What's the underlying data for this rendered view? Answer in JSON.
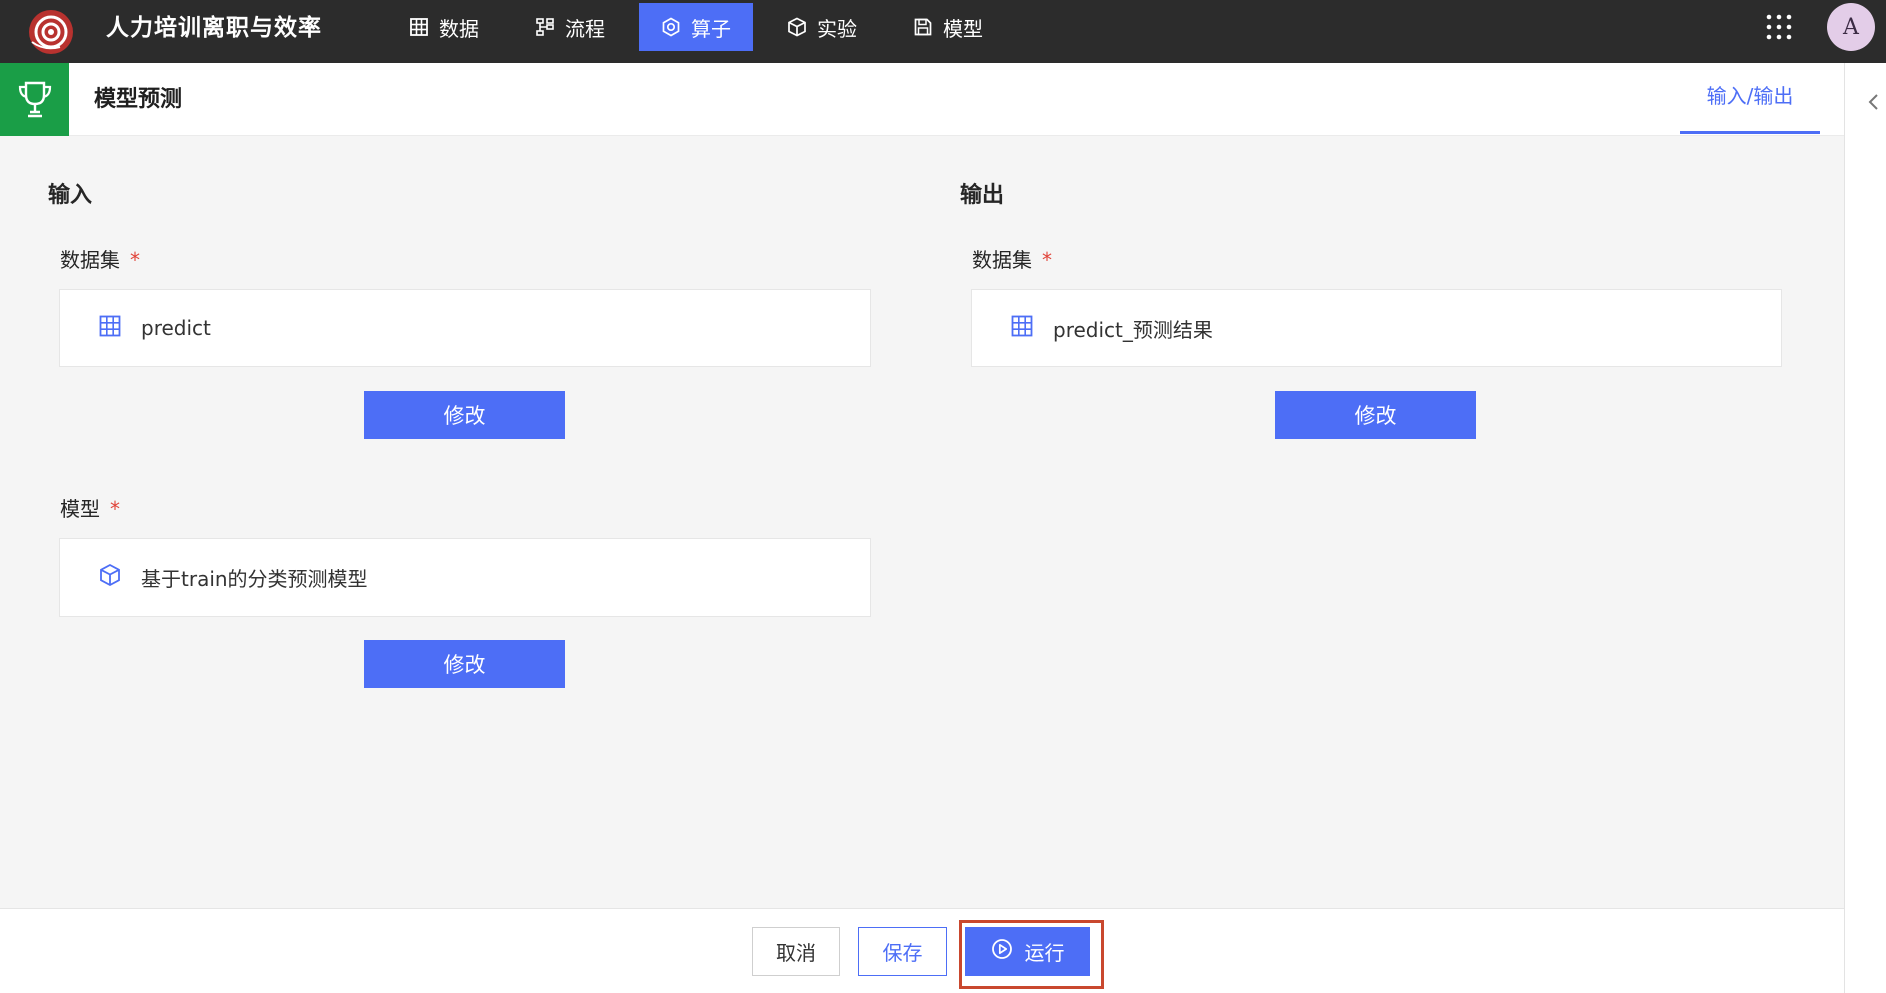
{
  "app": {
    "title": "人力培训离职与效率",
    "avatar_initial": "A",
    "logo_icon": "app-logo-icon",
    "apps_icon": "apps-grid-icon"
  },
  "nav": {
    "active_index": 2,
    "items": [
      {
        "label": "数据",
        "icon": "table-icon"
      },
      {
        "label": "流程",
        "icon": "flow-icon"
      },
      {
        "label": "算子",
        "icon": "operator-icon"
      },
      {
        "label": "实验",
        "icon": "cube-icon"
      },
      {
        "label": "模型",
        "icon": "save-icon"
      }
    ]
  },
  "header": {
    "title": "模型预测",
    "icon": "trophy-icon",
    "tab_label": "输入/输出",
    "side_toggle_icon": "chevron-left-icon"
  },
  "input": {
    "heading": "输入",
    "dataset": {
      "label": "数据集",
      "required": "*",
      "value": "predict",
      "icon": "table-icon",
      "button": "修改"
    },
    "model": {
      "label": "模型",
      "required": "*",
      "value": "基于train的分类预测模型",
      "icon": "cube-icon",
      "button": "修改"
    }
  },
  "output": {
    "heading": "输出",
    "dataset": {
      "label": "数据集",
      "required": "*",
      "value": "predict_预测结果",
      "icon": "table-icon",
      "button": "修改"
    }
  },
  "footer": {
    "cancel": "取消",
    "save": "保存",
    "run": "运行",
    "run_icon": "play-circle-icon"
  },
  "colors": {
    "topbar": "#2c2c2c",
    "accent": "#4d6ef6",
    "success": "#1a9e47",
    "required": "#e0443a",
    "highlight": "#c9482e",
    "canvas": "#f5f5f5"
  }
}
